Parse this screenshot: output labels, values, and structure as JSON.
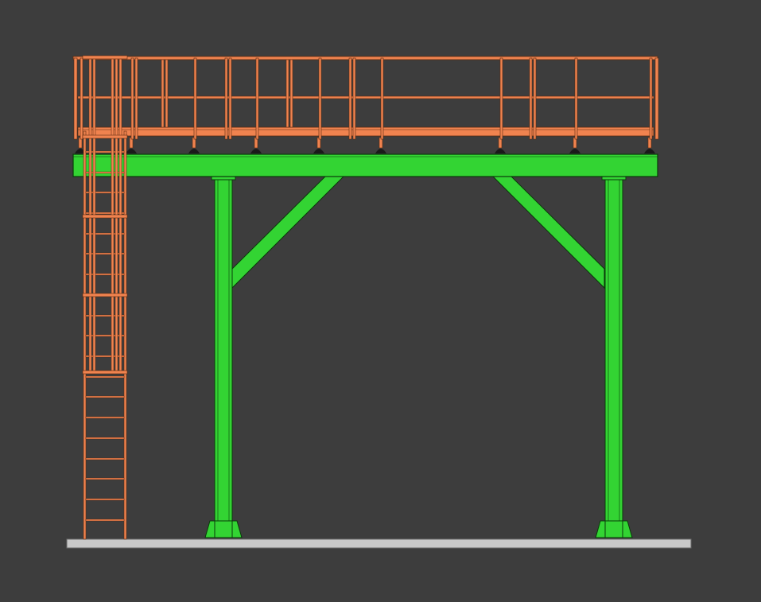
{
  "scene": {
    "title": "",
    "colors": {
      "background": "#3d3d3d",
      "structure": "#33d433",
      "structure_edge": "#0a3a0a",
      "railing": "#f0834f",
      "railing_edge": "#5a2a10",
      "floor": "#c8c8c8",
      "floor_edge": "#6a6a6a",
      "fastener": "#1a1a1a"
    },
    "parts": [
      "floor-slab",
      "deck-beam",
      "column-left",
      "column-right",
      "brace-left",
      "brace-right",
      "column-base-left",
      "column-base-right",
      "railing-top-rail",
      "railing-mid-rail",
      "toe-board",
      "railing-posts",
      "deck-fasteners",
      "access-ladder",
      "ladder-cage"
    ]
  }
}
